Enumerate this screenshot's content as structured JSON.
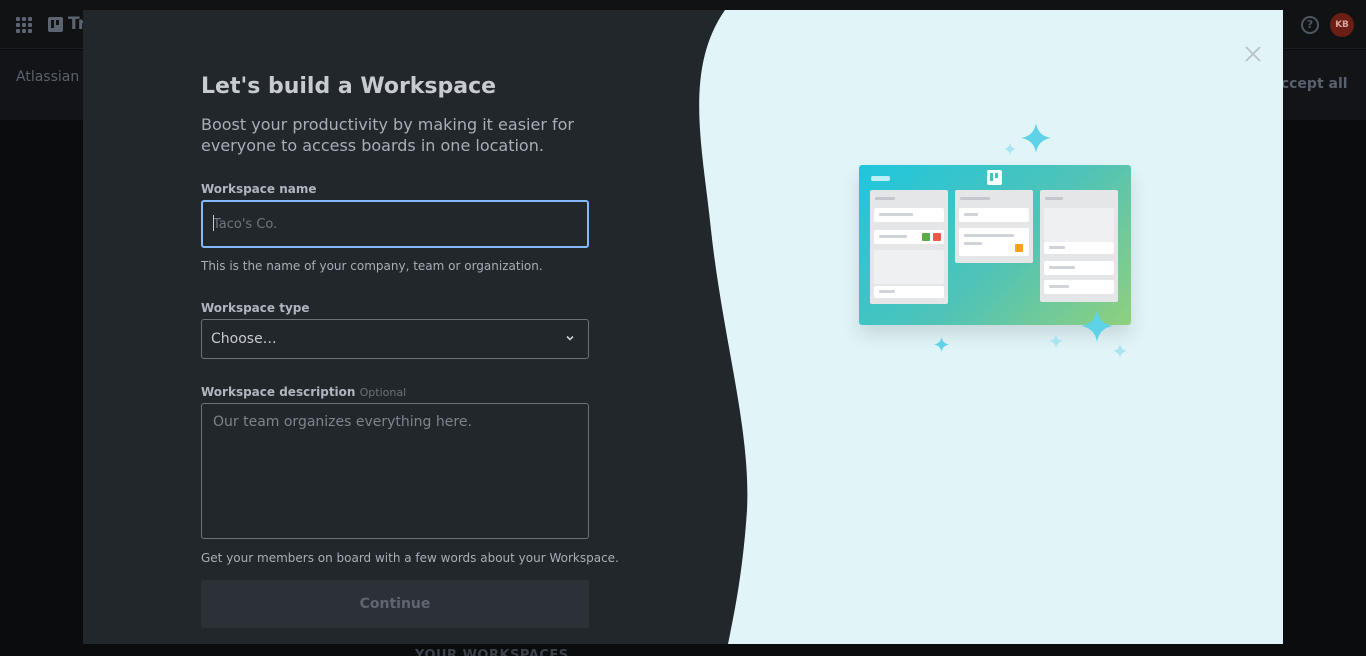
{
  "background": {
    "app_name": "Trello",
    "banner_text": "Atlassian uses cookies to improve your browsing experience, perform analytics and research, and conduct advertising. Accept all cookies to indicate that you agree",
    "banner_button": "Accept all",
    "avatar_initials": "KB",
    "help_icon": "?",
    "footer_text": "YOUR WORKSPACES"
  },
  "modal": {
    "title": "Let's build a Workspace",
    "subtitle": "Boost your productivity by making it easier for everyone to access boards in one location.",
    "name_label": "Workspace name",
    "name_placeholder": "Taco's Co.",
    "name_value": "",
    "name_help": "This is the name of your company, team or organization.",
    "type_label": "Workspace type",
    "type_value": "Choose…",
    "description_label": "Workspace description",
    "description_optional": "Optional",
    "description_placeholder": "Our team organizes everything here.",
    "description_help": "Get your members on board with a few words about your Workspace.",
    "continue_label": "Continue",
    "close_icon": "close-icon"
  },
  "colors": {
    "panel": "#22272b",
    "illustration_bg": "#e1f5f9",
    "focus_border": "#85b8ff"
  }
}
